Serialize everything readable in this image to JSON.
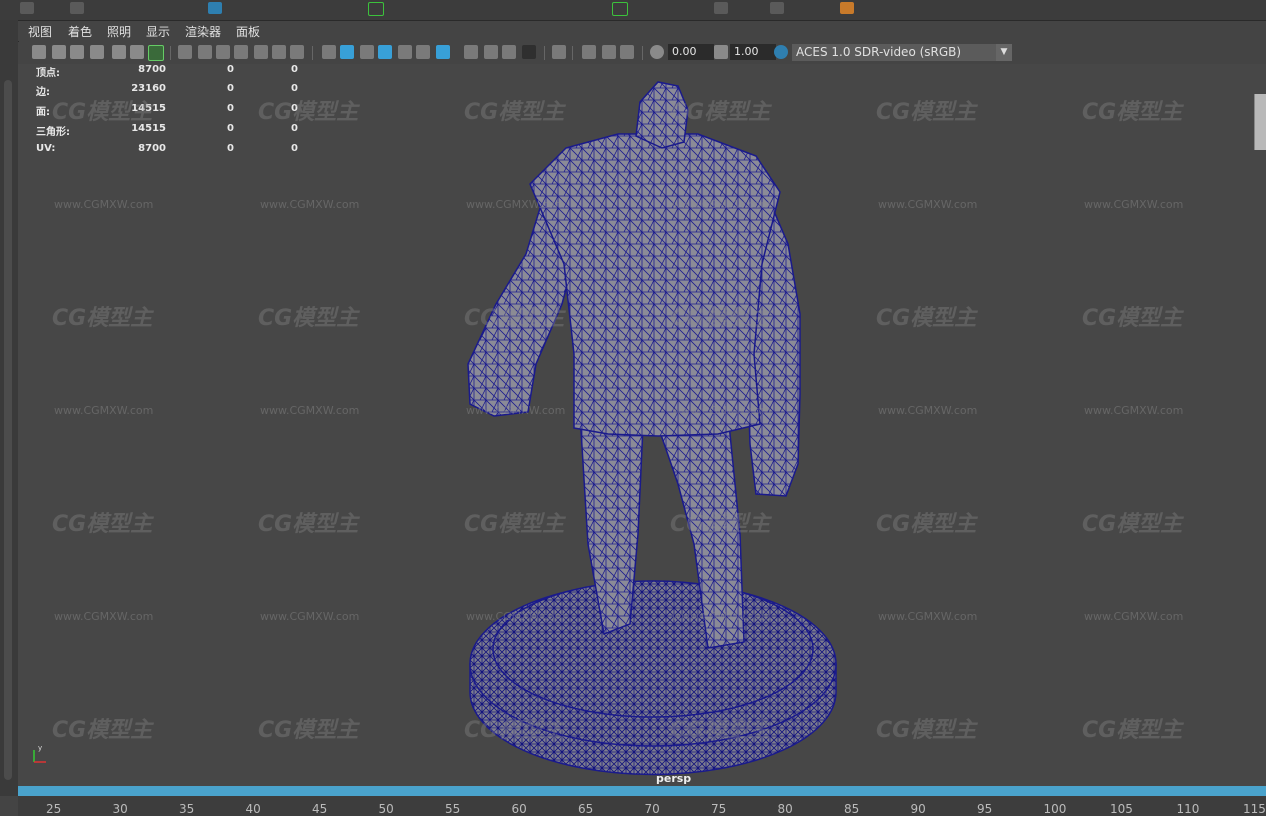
{
  "menu": {
    "items": [
      "视图",
      "着色",
      "照明",
      "显示",
      "渲染器",
      "面板"
    ]
  },
  "toolbar": {
    "exposure_value": "0.00",
    "gamma_value": "1.00",
    "color_space": "ACES 1.0 SDR-video (sRGB)"
  },
  "hud": {
    "rows": [
      {
        "label": "顶点:",
        "total": "8700",
        "selected": "0",
        "extra": "0"
      },
      {
        "label": "边:",
        "total": "23160",
        "selected": "0",
        "extra": "0"
      },
      {
        "label": "面:",
        "total": "14515",
        "selected": "0",
        "extra": "0"
      },
      {
        "label": "三角形:",
        "total": "14515",
        "selected": "0",
        "extra": "0"
      },
      {
        "label": "UV:",
        "total": "8700",
        "selected": "0",
        "extra": "0"
      }
    ]
  },
  "viewport": {
    "camera_label": "persp",
    "watermark_text": "CG模型主",
    "watermark_url": "www.CGMXW.com",
    "axis_label": "y"
  },
  "timeline": {
    "ticks": [
      "25",
      "30",
      "35",
      "40",
      "45",
      "50",
      "55",
      "60",
      "65",
      "70",
      "75",
      "80",
      "85",
      "90",
      "95",
      "100",
      "105",
      "110",
      "115"
    ]
  },
  "colors": {
    "wire": "#1a1a8c",
    "mesh_fill": "#8a8a96",
    "timeline_accent": "#4aa3cc"
  }
}
